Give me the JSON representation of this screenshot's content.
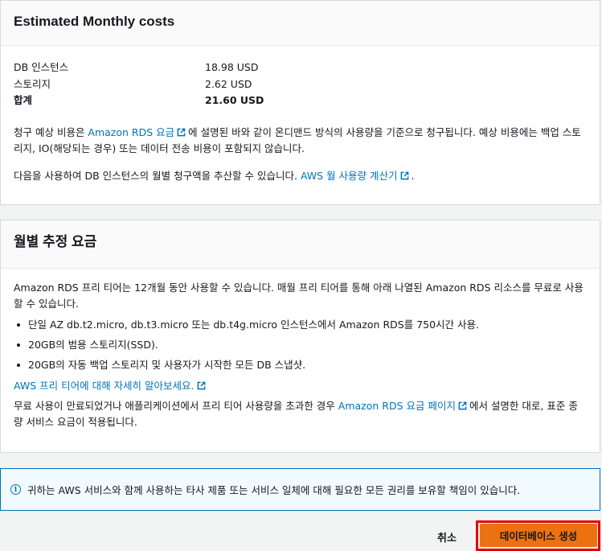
{
  "estimated_costs": {
    "title": "Estimated Monthly costs",
    "rows": [
      {
        "label": "DB 인스턴스",
        "value": "18.98 USD"
      },
      {
        "label": "스토리지",
        "value": "2.62 USD"
      },
      {
        "label": "합계",
        "value": "21.60 USD"
      }
    ],
    "note1_prefix": "청구 예상 비용은 ",
    "note1_link": "Amazon RDS 요금",
    "note1_suffix": "에 설명된 바와 같이 온디맨드 방식의 사용량을 기준으로 청구됩니다. 예상 비용에는 백업 스토리지, IO(해당되는 경우) 또는 데이터 전송 비용이 포함되지 않습니다.",
    "note2_prefix": "다음을 사용하여 DB 인스턴스의 월별 청구액을 추산할 수 있습니다. ",
    "note2_link": "AWS 월 사용량 계산기",
    "note2_suffix": "."
  },
  "free_tier": {
    "title": "월별 추정 요금",
    "intro": "Amazon RDS 프리 티어는 12개월 동안 사용할 수 있습니다. 매월 프리 티어를 통해 아래 나열된 Amazon RDS 리소스를 무료로 사용할 수 있습니다.",
    "bullets": [
      "단일 AZ db.t2.micro, db.t3.micro 또는 db.t4g.micro 인스턴스에서 Amazon RDS를 750시간 사용.",
      "20GB의 범용 스토리지(SSD).",
      "20GB의 자동 백업 스토리지 및 사용자가 시작한 모든 DB 스냅샷."
    ],
    "learn_more_link": "AWS 프리 티어에 대해 자세히 알아보세요.",
    "outro_prefix": "무료 사용이 만료되었거나 애플리케이션에서 프리 티어 사용량을 초과한 경우 ",
    "outro_link": "Amazon RDS 요금 페이지",
    "outro_suffix": "에서 설명한 대로, 표준 종량 서비스 요금이 적용됩니다."
  },
  "info": {
    "icon": "info-icon",
    "text": "귀하는 AWS 서비스와 함께 사용하는 타사 제품 또는 서비스 일체에 대해 필요한 모든 권리를 보유할 책임이 있습니다."
  },
  "actions": {
    "cancel_label": "취소",
    "create_label": "데이터베이스 생성"
  },
  "colors": {
    "link": "#0073bb",
    "primary_button": "#ec7211",
    "highlight": "#e00000",
    "info_border": "#0073bb"
  }
}
